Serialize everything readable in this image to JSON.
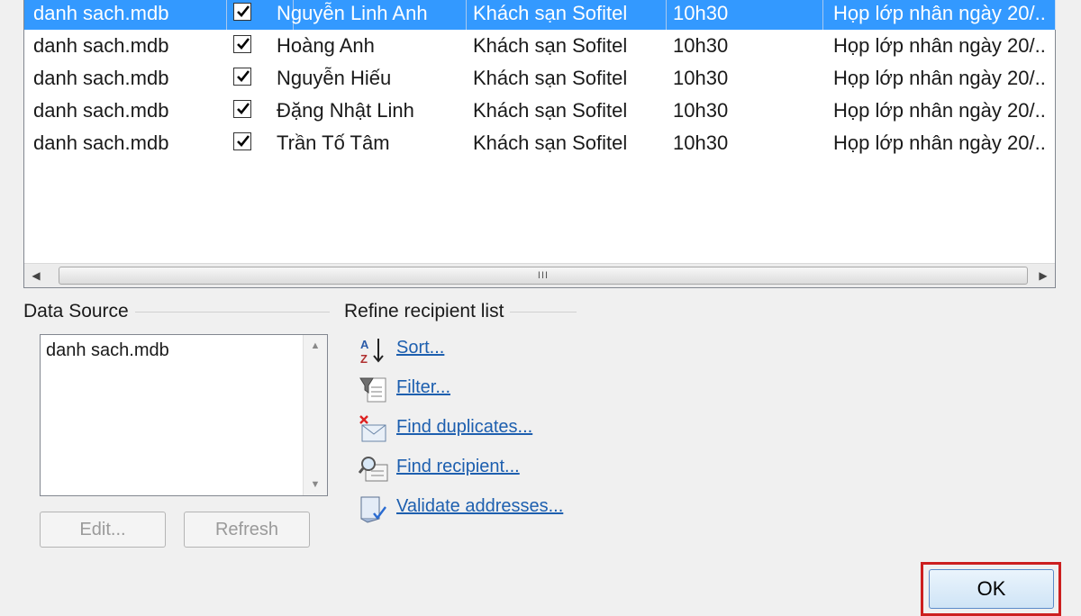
{
  "recipient_list": {
    "rows": [
      {
        "source": "danh sach.mdb",
        "checked": true,
        "name": "Nguyễn Linh Anh",
        "location": "Khách sạn Sofitel",
        "time": "10h30",
        "note": "Họp lớp nhân ngày 20/..",
        "selected": true
      },
      {
        "source": "danh sach.mdb",
        "checked": true,
        "name": "Hoàng Anh",
        "location": "Khách sạn Sofitel",
        "time": "10h30",
        "note": "Họp lớp nhân ngày 20/..",
        "selected": false
      },
      {
        "source": "danh sach.mdb",
        "checked": true,
        "name": "Nguyễn Hiếu",
        "location": "Khách sạn Sofitel",
        "time": "10h30",
        "note": "Họp lớp nhân ngày 20/..",
        "selected": false
      },
      {
        "source": "danh sach.mdb",
        "checked": true,
        "name": "Đặng Nhật Linh",
        "location": "Khách sạn Sofitel",
        "time": "10h30",
        "note": "Họp lớp nhân ngày 20/..",
        "selected": false
      },
      {
        "source": "danh sach.mdb",
        "checked": true,
        "name": "Trần Tố Tâm",
        "location": "Khách sạn Sofitel",
        "time": "10h30",
        "note": "Họp lớp nhân ngày 20/..",
        "selected": false
      }
    ],
    "scroll_grip": "III"
  },
  "data_source": {
    "label": "Data Source",
    "items": [
      "danh sach.mdb"
    ],
    "edit_label": "Edit...",
    "refresh_label": "Refresh"
  },
  "refine": {
    "label": "Refine recipient list",
    "items": [
      {
        "icon": "sort-az-icon",
        "label": "Sort..."
      },
      {
        "icon": "filter-icon",
        "label": "Filter..."
      },
      {
        "icon": "find-duplicates-icon",
        "label": "Find duplicates..."
      },
      {
        "icon": "find-recipient-icon",
        "label": "Find recipient..."
      },
      {
        "icon": "validate-addresses-icon",
        "label": "Validate addresses..."
      }
    ]
  },
  "ok_label": "OK",
  "colors": {
    "selection": "#3399ff",
    "link": "#1d5faf",
    "highlight_border": "#cc1f1f"
  }
}
